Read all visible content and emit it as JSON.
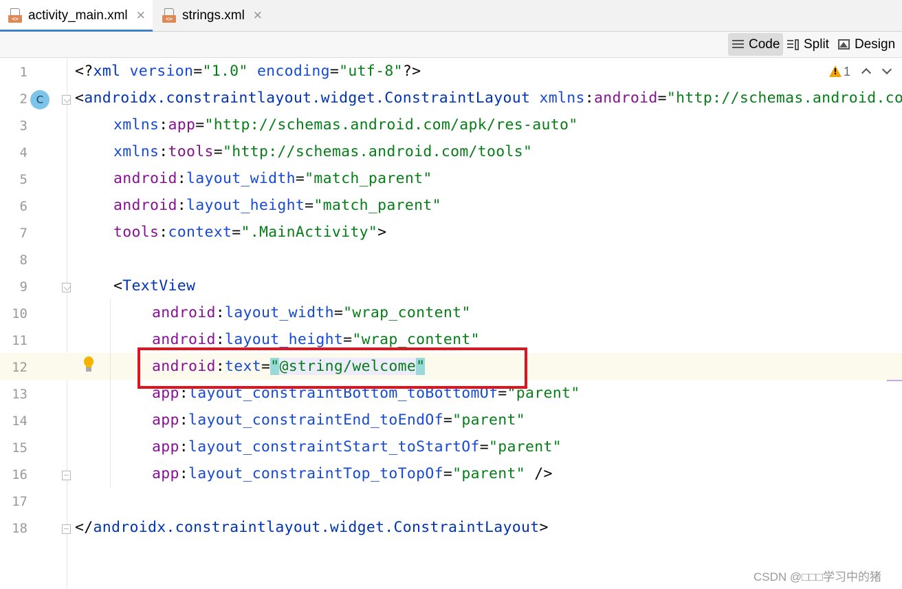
{
  "tabs": [
    {
      "label": "activity_main.xml",
      "file_badge": "<>",
      "active": true
    },
    {
      "label": "strings.xml",
      "file_badge": "<>",
      "active": false
    }
  ],
  "view_modes": {
    "code": "Code",
    "split": "Split",
    "design": "Design",
    "active": "Code"
  },
  "inspections": {
    "warning_count": "1"
  },
  "gutter": {
    "class_badge": "C"
  },
  "line_numbers": [
    "1",
    "2",
    "3",
    "4",
    "5",
    "6",
    "7",
    "8",
    "9",
    "10",
    "11",
    "12",
    "13",
    "14",
    "15",
    "16",
    "17",
    "18"
  ],
  "code": {
    "l1": {
      "open": "<?",
      "tag": "xml",
      "sp1": " ",
      "a1": "version",
      "eq1": "=",
      "v1": "\"1.0\"",
      "sp2": " ",
      "a2": "encoding",
      "eq2": "=",
      "v2": "\"utf-8\"",
      "close": "?>"
    },
    "l2": {
      "open": "<",
      "tag": "androidx.constraintlayout.widget.ConstraintLayout",
      "sp": " ",
      "ns": "xmlns",
      "colon": ":",
      "an": "android",
      "eq": "=",
      "val": "\"http://schemas.android.com/apk/res/android\""
    },
    "l3": {
      "ns": "xmlns",
      "colon": ":",
      "an": "app",
      "eq": "=",
      "val": "\"http://schemas.android.com/apk/res-auto\""
    },
    "l4": {
      "ns": "xmlns",
      "colon": ":",
      "an": "tools",
      "eq": "=",
      "val": "\"http://schemas.android.com/tools\""
    },
    "l5": {
      "ns": "android",
      "colon": ":",
      "an": "layout_width",
      "eq": "=",
      "val": "\"match_parent\""
    },
    "l6": {
      "ns": "android",
      "colon": ":",
      "an": "layout_height",
      "eq": "=",
      "val": "\"match_parent\""
    },
    "l7": {
      "ns": "tools",
      "colon": ":",
      "an": "context",
      "eq": "=",
      "val": "\".MainActivity\"",
      "close": ">"
    },
    "l9": {
      "open": "<",
      "tag": "TextView"
    },
    "l10": {
      "ns": "android",
      "colon": ":",
      "an": "layout_width",
      "eq": "=",
      "val": "\"wrap_content\""
    },
    "l11": {
      "ns": "android",
      "colon": ":",
      "an": "layout_height",
      "eq": "=",
      "val": "\"wrap_content\""
    },
    "l12": {
      "ns": "android",
      "colon": ":",
      "an": "text",
      "eq": "=",
      "q1": "\"",
      "val": "@string/welcome",
      "q2": "\""
    },
    "l13": {
      "ns": "app",
      "colon": ":",
      "an": "layout_constraintBottom_toBottomOf",
      "eq": "=",
      "val": "\"parent\""
    },
    "l14": {
      "ns": "app",
      "colon": ":",
      "an": "layout_constraintEnd_toEndOf",
      "eq": "=",
      "val": "\"parent\""
    },
    "l15": {
      "ns": "app",
      "colon": ":",
      "an": "layout_constraintStart_toStartOf",
      "eq": "=",
      "val": "\"parent\""
    },
    "l16": {
      "ns": "app",
      "colon": ":",
      "an": "layout_constraintTop_toTopOf",
      "eq": "=",
      "val": "\"parent\"",
      "close": " />"
    },
    "l18": {
      "open": "</",
      "tag": "androidx.constraintlayout.widget.ConstraintLayout",
      "close": ">"
    }
  },
  "watermark": "CSDN @□□□学习中的猪",
  "colors": {
    "tag": "#0033b3",
    "namespace": "#871094",
    "attribute": "#174ad4",
    "string": "#067d17",
    "highlight_box": "#e0141e",
    "tab_underline": "#4083c9"
  }
}
